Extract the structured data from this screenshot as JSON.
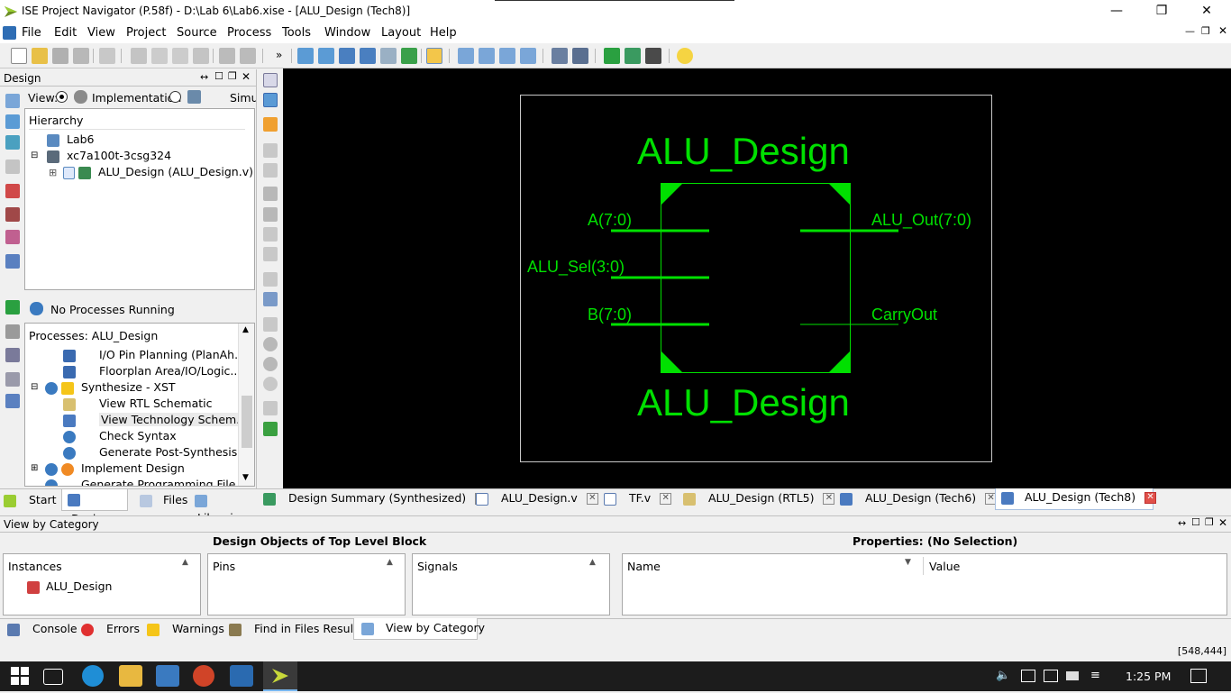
{
  "window": {
    "title": "ISE Project Navigator (P.58f) - D:\\Lab 6\\Lab6.xise - [ALU_Design (Tech8)]",
    "minimize": "—",
    "maximize": "❐",
    "close": "✕"
  },
  "menu": [
    "File",
    "Edit",
    "View",
    "Project",
    "Source",
    "Process",
    "Tools",
    "Window",
    "Layout",
    "Help"
  ],
  "design_panel": {
    "title": "Design",
    "view_label": "View:",
    "view_impl": "Implementation",
    "view_sim": "Simulation",
    "hierarchy_label": "Hierarchy",
    "tree": [
      "Lab6",
      "xc7a100t-3csg324",
      "ALU_Design (ALU_Design.v)"
    ],
    "tree_toggle": "⊞",
    "process_status": "No Processes Running",
    "processes_title": "Processes: ALU_Design",
    "processes": [
      "I/O Pin Planning (PlanAh...",
      "Floorplan Area/IO/Logic...",
      "Synthesize - XST",
      "View RTL Schematic",
      "View Technology Schem...",
      "Check Syntax",
      "Generate Post-Synthesis...",
      "Implement Design",
      "Generate Programming File"
    ],
    "bottom_tabs": [
      "Start",
      "Design",
      "Files",
      "Libraries"
    ]
  },
  "schematic": {
    "top_label": "ALU_Design",
    "bottom_label": "ALU_Design",
    "pins": {
      "a": "A(7:0)",
      "sel": "ALU_Sel(3:0)",
      "b": "B(7:0)",
      "out": "ALU_Out(7:0)",
      "carry": "CarryOut"
    },
    "color": "#00e000"
  },
  "editor_tabs": [
    "Design Summary (Synthesized)",
    "ALU_Design.v",
    "TF.v",
    "ALU_Design (RTL5)",
    "ALU_Design (Tech6)",
    "ALU_Design (Tech8)"
  ],
  "view_by_category": {
    "title": "View by Category",
    "design_objects_title": "Design Objects of Top Level Block",
    "properties_title": "Properties: (No Selection)",
    "instances_header": "Instances",
    "instance_item": "ALU_Design",
    "pins_header": "Pins",
    "signals_header": "Signals",
    "name_header": "Name",
    "value_header": "Value",
    "sort_arrow": "▲",
    "sort_arrow_down": "▼"
  },
  "console_tabs": [
    "Console",
    "Errors",
    "Warnings",
    "Find in Files Results",
    "View by Category"
  ],
  "status_coords": "[548,444]",
  "taskbar": {
    "time": "1:25 PM"
  }
}
